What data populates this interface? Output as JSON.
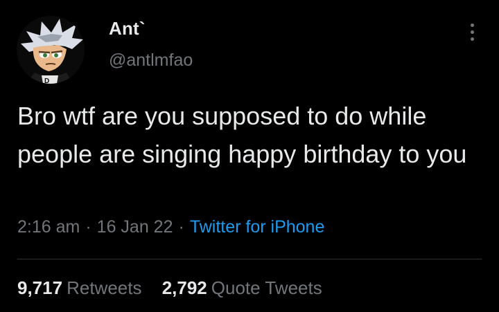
{
  "author": {
    "display_name": "Ant`",
    "handle": "@antlmfao"
  },
  "tweet": {
    "text": "Bro wtf are you supposed to do while people are singing happy birthday to you",
    "time": "2:16 am",
    "date": "16 Jan 22",
    "source": "Twitter for iPhone",
    "separator": "·"
  },
  "stats": {
    "retweets_count": "9,717",
    "retweets_label": "Retweets",
    "quotes_count": "2,792",
    "quotes_label": "Quote Tweets"
  },
  "colors": {
    "background": "#000000",
    "primary_text": "#e7e9ea",
    "secondary_text": "#71767b",
    "accent": "#1d9bf0",
    "divider": "#2f3336"
  },
  "icons": {
    "more": "more-options-icon"
  }
}
